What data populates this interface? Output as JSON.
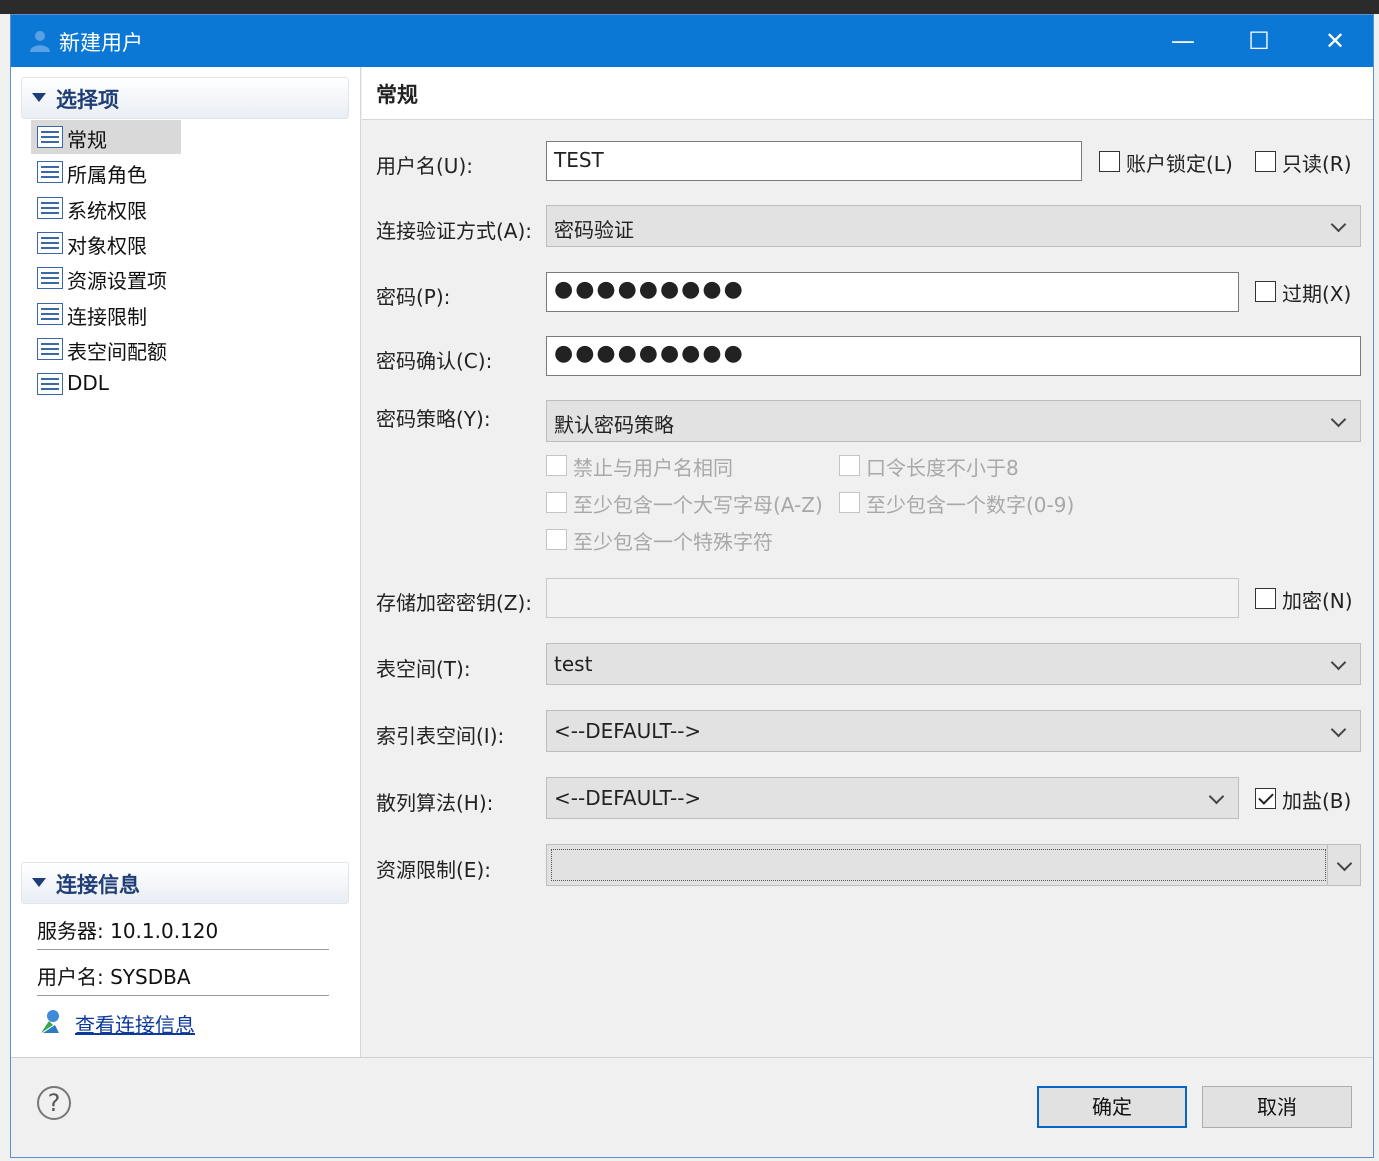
{
  "window": {
    "title": "新建用户",
    "minimize": "—",
    "maximize": "☐",
    "close": "✕"
  },
  "left": {
    "options_header": "选择项",
    "nav": [
      {
        "label": "常规",
        "selected": true
      },
      {
        "label": "所属角色"
      },
      {
        "label": "系统权限"
      },
      {
        "label": "对象权限"
      },
      {
        "label": "资源设置项"
      },
      {
        "label": "连接限制"
      },
      {
        "label": "表空间配额"
      },
      {
        "label": "DDL"
      }
    ],
    "conn_header": "连接信息",
    "server": "服务器: 10.1.0.120",
    "user": "用户名: SYSDBA",
    "view_link": "查看连接信息"
  },
  "form": {
    "section_title": "常规",
    "username_label": "用户名(U):",
    "username_value": "TEST",
    "account_lock_label": "账户锁定(L)",
    "readonly_label": "只读(R)",
    "auth_label": "连接验证方式(A):",
    "auth_value": "密码验证",
    "password_label": "密码(P):",
    "password_value": "●●●●●●●●●",
    "expire_label": "过期(X)",
    "confirm_label": "密码确认(C):",
    "confirm_value": "●●●●●●●●●",
    "policy_label": "密码策略(Y):",
    "policy_value": "默认密码策略",
    "policy_options": [
      "禁止与用户名相同",
      "口令长度不小于8",
      "至少包含一个大写字母(A-Z)",
      "至少包含一个数字(0-9)",
      "至少包含一个特殊字符"
    ],
    "storage_key_label": "存储加密密钥(Z):",
    "encrypt_label": "加密(N)",
    "tablespace_label": "表空间(T):",
    "tablespace_value": "test",
    "index_ts_label": "索引表空间(I):",
    "index_ts_value": "<--DEFAULT-->",
    "hash_label": "散列算法(H):",
    "hash_value": "<--DEFAULT-->",
    "salt_label": "加盐(B)",
    "salt_checked": true,
    "resource_label": "资源限制(E):",
    "resource_value": ""
  },
  "footer": {
    "help": "?",
    "ok": "确定",
    "cancel": "取消"
  }
}
